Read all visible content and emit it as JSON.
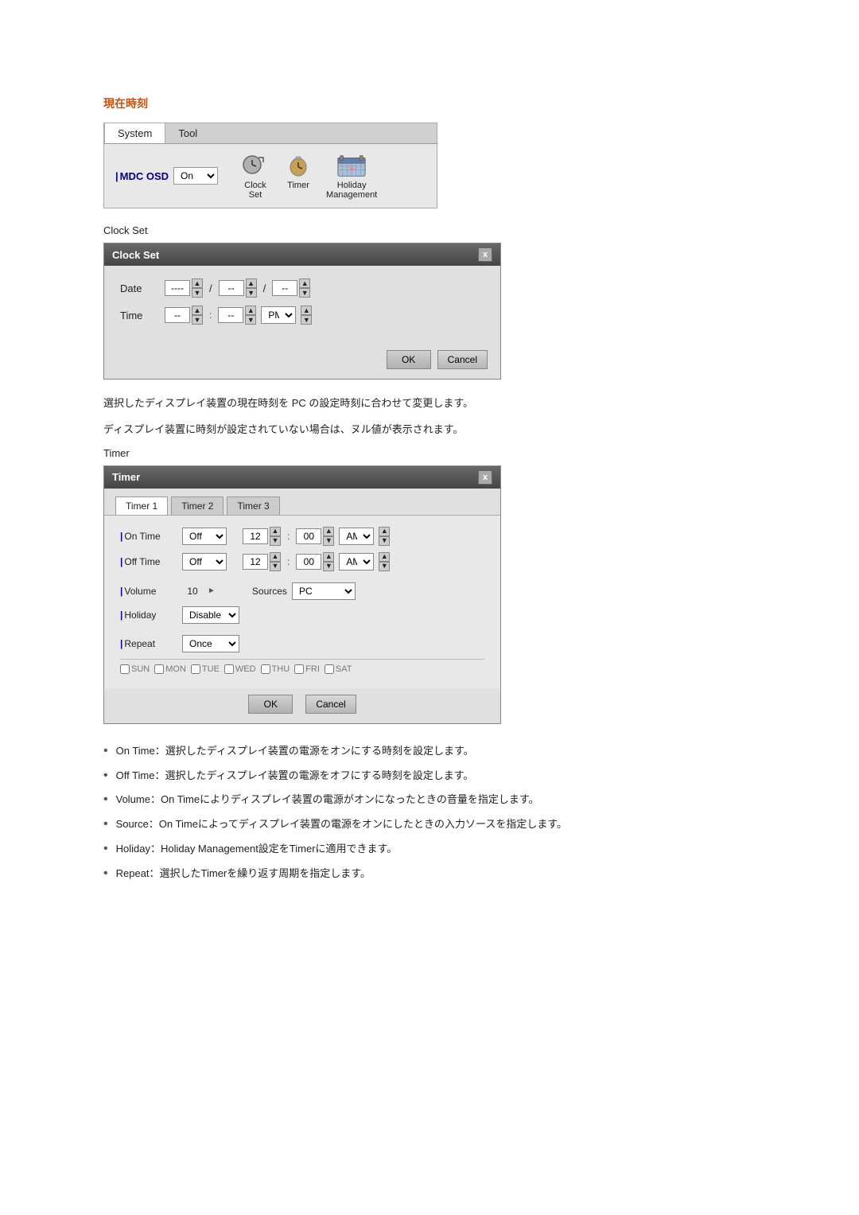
{
  "page": {
    "section_title": "現在時刻",
    "app": {
      "menu_items": [
        "System",
        "Tool"
      ],
      "active_menu": "System",
      "mdc_osd_label": "MDC OSD",
      "on_value": "On",
      "icons": [
        {
          "label_line1": "Clock",
          "label_line2": "Set",
          "name": "clock-icon"
        },
        {
          "label_line1": "Timer",
          "label_line2": "",
          "name": "timer-icon"
        },
        {
          "label_line1": "Holiday",
          "label_line2": "Management",
          "name": "holiday-icon"
        }
      ]
    },
    "clock_set_label": "Clock Set",
    "clock_dialog": {
      "title": "Clock Set",
      "close_btn": "x",
      "date_label": "Date",
      "date_val1": "----",
      "date_sep1": "/",
      "date_val2": "--",
      "date_sep2": "/",
      "date_val3": "--",
      "time_label": "Time",
      "time_val1": "--",
      "time_sep": ":",
      "time_val2": "--",
      "time_ampm": "PM",
      "btn_ok": "OK",
      "btn_cancel": "Cancel"
    },
    "desc1": "選択したディスプレイ装置の現在時刻を PC の設定時刻に合わせて変更します。",
    "desc2": "ディスプレイ装置に時刻が設定されていない場合は、ヌル値が表示されます。",
    "timer_label": "Timer",
    "timer_dialog": {
      "title": "Timer",
      "close_btn": "x",
      "tabs": [
        "Timer 1",
        "Timer 2",
        "Timer 3"
      ],
      "active_tab": "Timer 1",
      "on_time_label": "On Time",
      "on_time_mode": "Off",
      "on_time_hour": "12",
      "on_time_min": "00",
      "on_time_ampm": "AM",
      "off_time_label": "Off Time",
      "off_time_mode": "Off",
      "off_time_hour": "12",
      "off_time_min": "00",
      "off_time_ampm": "AM",
      "volume_label": "Volume",
      "volume_val": "10",
      "sources_label": "Sources",
      "sources_val": "PC",
      "holiday_label": "Holiday",
      "holiday_val": "Disable",
      "repeat_label": "Repeat",
      "repeat_val": "Once",
      "days": [
        "SUN",
        "MON",
        "TUE",
        "WED",
        "THU",
        "FRI",
        "SAT"
      ],
      "btn_ok": "OK",
      "btn_cancel": "Cancel"
    },
    "bullets": [
      "On Time：選択したディスプレイ装置の電源をオンにする時刻を設定します。",
      "Off Time：選択したディスプレイ装置の電源をオフにする時刻を設定します。",
      "Volume：On Timeによりディスプレイ装置の電源がオンになったときの音量を指定します。",
      "Source：On Timeによってディスプレイ装置の電源をオンにしたときの入力ソースを指定します。",
      "Holiday：Holiday Management設定をTimerに適用できます。",
      "Repeat：選択したTimerを繰り返す周期を指定します。"
    ]
  }
}
